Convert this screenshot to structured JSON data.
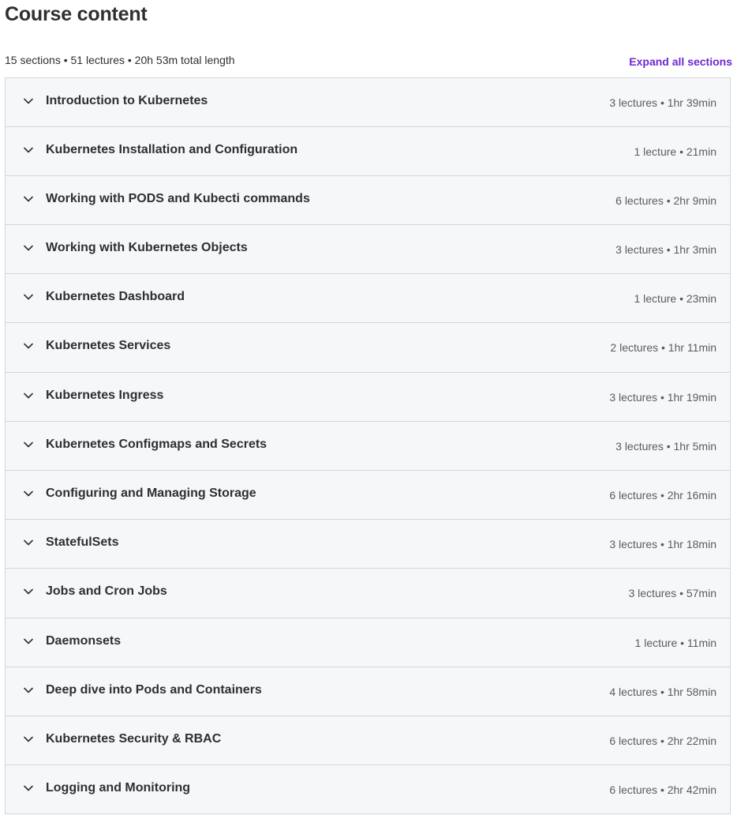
{
  "header": {
    "title": "Course content",
    "summary": "15 sections • 51 lectures • 20h 53m total length",
    "expand_label": "Expand all sections"
  },
  "colors": {
    "accent": "#6d28d2",
    "row_background": "#f6f7f9",
    "border": "#d1d7dc"
  },
  "sections": [
    {
      "title": "Introduction to Kubernetes",
      "meta": "3 lectures • 1hr 39min"
    },
    {
      "title": "Kubernetes Installation and Configuration",
      "meta": "1 lecture • 21min"
    },
    {
      "title": "Working with PODS and Kubecti commands",
      "meta": "6 lectures • 2hr 9min"
    },
    {
      "title": "Working with Kubernetes Objects",
      "meta": "3 lectures • 1hr 3min"
    },
    {
      "title": "Kubernetes Dashboard",
      "meta": "1 lecture • 23min"
    },
    {
      "title": "Kubernetes Services",
      "meta": "2 lectures • 1hr 11min"
    },
    {
      "title": "Kubernetes Ingress",
      "meta": "3 lectures • 1hr 19min"
    },
    {
      "title": "Kubernetes Configmaps and Secrets",
      "meta": "3 lectures • 1hr 5min"
    },
    {
      "title": "Configuring and Managing Storage",
      "meta": "6 lectures • 2hr 16min"
    },
    {
      "title": "StatefulSets",
      "meta": "3 lectures • 1hr 18min"
    },
    {
      "title": "Jobs and Cron Jobs",
      "meta": "3 lectures • 57min"
    },
    {
      "title": "Daemonsets",
      "meta": "1 lecture • 11min"
    },
    {
      "title": "Deep dive into Pods and Containers",
      "meta": "4 lectures • 1hr 58min"
    },
    {
      "title": "Kubernetes Security & RBAC",
      "meta": "6 lectures • 2hr 22min"
    },
    {
      "title": "Logging and Monitoring",
      "meta": "6 lectures • 2hr 42min"
    }
  ]
}
